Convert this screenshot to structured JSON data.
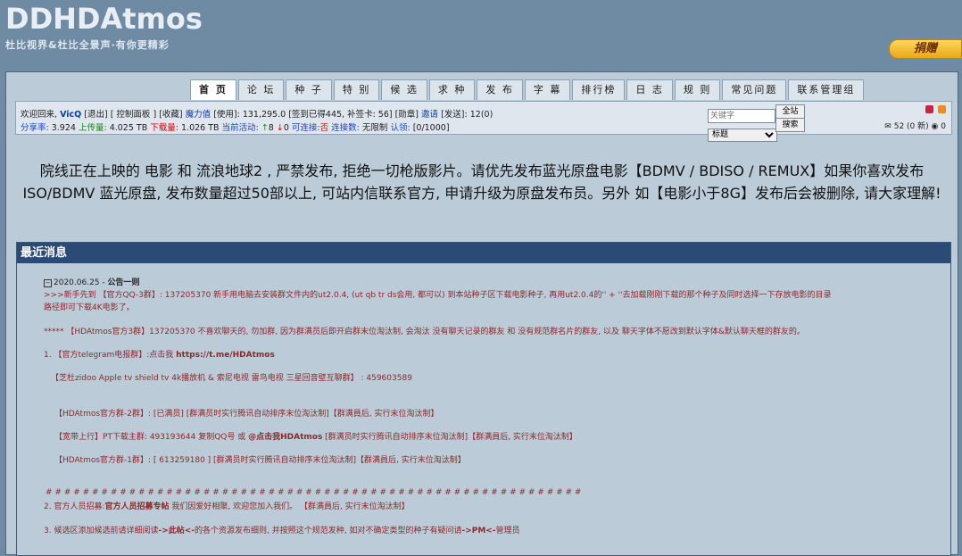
{
  "header": {
    "logo_main": "DDHDAtmos",
    "logo_sub": "杜比视界&杜比全景声·有你更精彩",
    "donate": "捐赠"
  },
  "nav": {
    "items": [
      "首 页",
      "论 坛",
      "种 子",
      "特 别",
      "候 选",
      "求 种",
      "发 布",
      "字 幕",
      "排行榜",
      "日 志",
      "规 则",
      "常见问题",
      "联系管理组"
    ]
  },
  "userbar": {
    "welcome": "欢迎回来,",
    "username": "VicQ",
    "exit": "[退出]",
    "panel": "[ 控制面板 ]",
    "fav": "[收藏]",
    "magic_label": "魔力值",
    "magic_text": "[使用]: 131,295.0 [签到已得445, 补签卡: 56] [勋章]",
    "invite": "邀请",
    "sent": "[发送]: 12(0)",
    "ratio_label": "分享率:",
    "ratio": "3.924",
    "up_label": "上传量:",
    "up": "4.025 TB",
    "down_label": "下载量:",
    "down": "1.026 TB",
    "active_label": "当前活动:",
    "active": "8",
    "active2": "0",
    "conn_label": "可连接:",
    "conn": "否",
    "conns_label": "连接数:",
    "conns": "无限制",
    "auth_label": "认领:",
    "auth": "[0/1000]",
    "msg": "52 (0 新)",
    "msg2": "0"
  },
  "search": {
    "placeholder": "关键字",
    "select_value": "标题",
    "all_btn": "全站",
    "search_btn": "搜索"
  },
  "announce": "院线正在上映的 电影 和 流浪地球2 , 严禁发布, 拒绝一切枪版影片。请优先发布蓝光原盘电影【BDMV / BDISO / REMUX】如果你喜欢发布ISO/BDMV 蓝光原盘, 发布数量超过50部以上, 可站内信联系官方, 申请升级为原盘发布员。另外 如【电影小于8G】发布后会被删除, 请大家理解!",
  "news": {
    "title": "最近消息",
    "date": "2020.06.25 -",
    "headline": "公告一则",
    "p1a": ">>>新手先到 【官方QQ-3群】: 137205370   新手用电脑去安装群文件内的ut2.0.4, (ut qb tr ds会用, 都可以) 到本站种子区下载电影种子, 再用ut2.0.4的'' + ''去加载刚刚下载的那个种子及同时选择一下存放电影的目录",
    "p1b": "路径即可下载4K电影了。",
    "p2": "***** 【HDAtmos官方3群】137205370   不喜欢聊天的, 勿加群, 因为群满员后即开启群末位淘汰制,  会淘汰  没有聊天记录的群友 和 没有规范群名片的群友, 以及 聊天字体不愿改到默认字体&默认聊天框的群友的。",
    "p3a": "1. 【官方telegram电报群】:点击我 ",
    "p3b": "https://t.me/HDAtmos",
    "p4": "【芝杜zidoo  Apple tv  shield tv 4k播放机 & 索尼电视 雷鸟电视 三星回音壁互聊群】 :  459603589",
    "p5": "【HDAtmos官方群-2群】: [已满员] [群满员时实行腾讯自动排序末位淘汰制]【群满員后, 实行末位淘汰制】",
    "p6a": "【宽带上行】PT下载主群: 493193644   复制QQ号 或 ",
    "p6b": "@点击我HDAtmos",
    "p6c": " [群满员时实行腾讯自动排序末位淘汰制]【群满員后, 实行末位淘汰制】",
    "p7": "【HDAtmos官方群-1群】:   [ 613259180 ] [群满员时实行腾讯自动排序末位淘汰制]【群满員后, 实行末位淘汰制】",
    "p8": "# # # # # # # # # # # # # # # # # # # # # # # # # # # # # # # # # # # # # # # # # # # # # # # # # # # # # # # # # #",
    "p9a": "2. 官方人员招募:",
    "p9b": "官方人员招募专帖",
    "p9c": " 我们因爱好相聚, 欢迎您加入我们。     【群满員后, 实行末位淘汰制】",
    "p10a": "3. 候选区添加候选前请详细阅读",
    "p10b": "->此帖<-",
    "p10c": "的各个资源发布细则, 并按照这个规范发种, 如对不确定类型的种子有疑问请",
    "p10d": "->PM<-",
    "p10e": "管理员"
  },
  "colors": {
    "background": "#6f8aa3",
    "panel": "#bccbd8",
    "news_header": "#2b4a75",
    "news_text": "#8a2a2a"
  }
}
